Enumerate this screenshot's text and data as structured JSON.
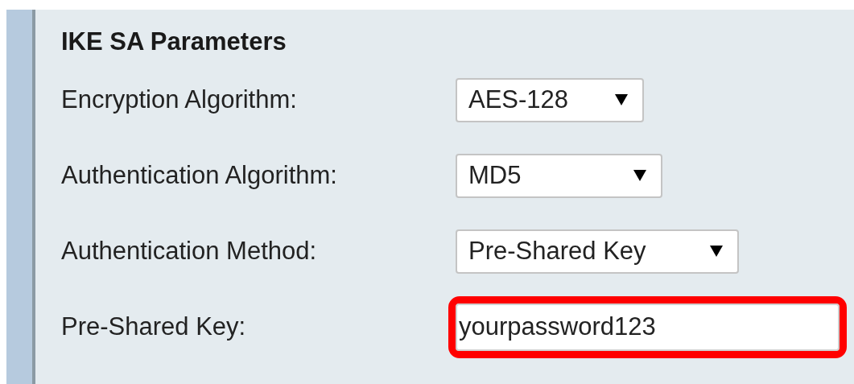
{
  "section": {
    "title": "IKE SA Parameters"
  },
  "fields": [
    {
      "kind": "select",
      "label": "Encryption Algorithm:",
      "value": "AES-128",
      "highlighted": false
    },
    {
      "kind": "select",
      "label": "Authentication Algorithm:",
      "value": "MD5",
      "highlighted": false
    },
    {
      "kind": "select",
      "label": "Authentication Method:",
      "value": "Pre-Shared Key",
      "highlighted": false
    },
    {
      "kind": "text",
      "label": "Pre-Shared Key:",
      "value": "yourpassword123",
      "highlighted": true
    }
  ]
}
